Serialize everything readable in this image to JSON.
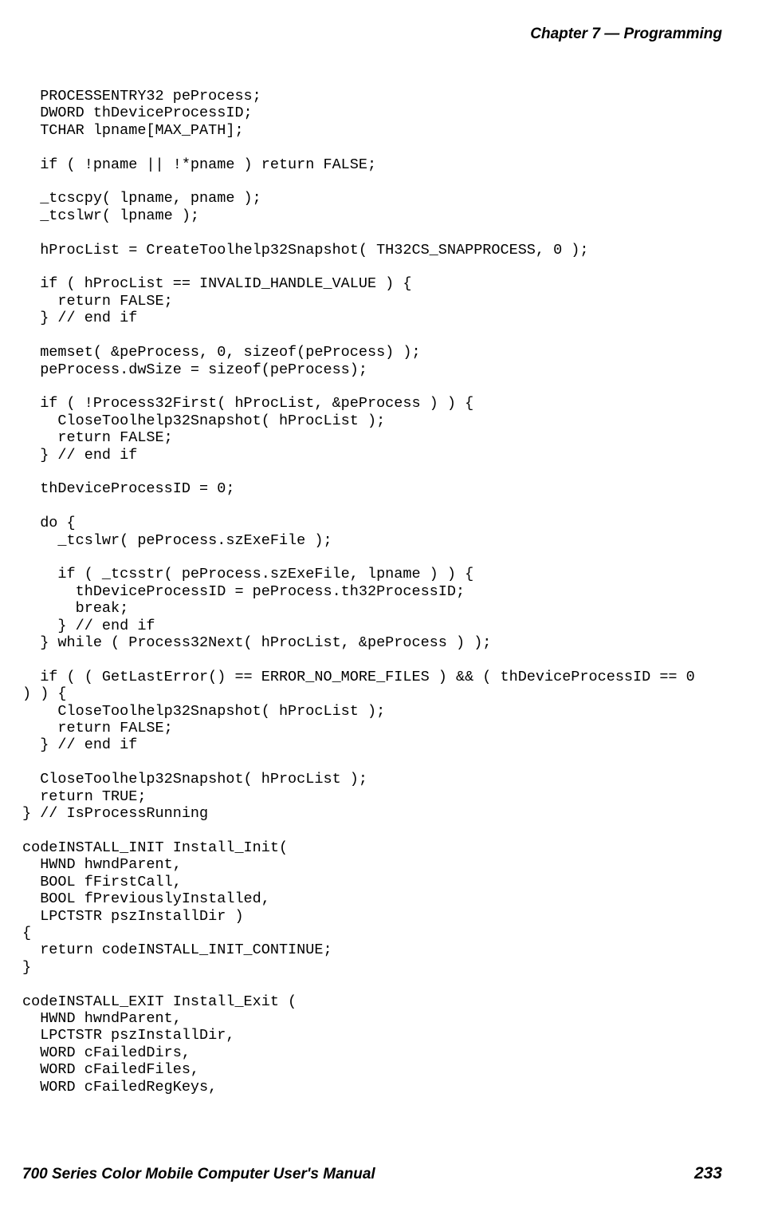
{
  "header": {
    "chapter": "Chapter 7 — Programming"
  },
  "code": "  PROCESSENTRY32 peProcess;\n  DWORD thDeviceProcessID;\n  TCHAR lpname[MAX_PATH];\n\n  if ( !pname || !*pname ) return FALSE;\n\n  _tcscpy( lpname, pname );\n  _tcslwr( lpname );\n\n  hProcList = CreateToolhelp32Snapshot( TH32CS_SNAPPROCESS, 0 );\n\n  if ( hProcList == INVALID_HANDLE_VALUE ) {\n    return FALSE;\n  } // end if\n\n  memset( &peProcess, 0, sizeof(peProcess) );\n  peProcess.dwSize = sizeof(peProcess);\n\n  if ( !Process32First( hProcList, &peProcess ) ) {\n    CloseToolhelp32Snapshot( hProcList );\n    return FALSE;\n  } // end if\n\n  thDeviceProcessID = 0;\n\n  do {\n    _tcslwr( peProcess.szExeFile );\n\n    if ( _tcsstr( peProcess.szExeFile, lpname ) ) {\n      thDeviceProcessID = peProcess.th32ProcessID;\n      break;\n    } // end if\n  } while ( Process32Next( hProcList, &peProcess ) );\n\n  if ( ( GetLastError() == ERROR_NO_MORE_FILES ) && ( thDeviceProcessID == 0\n) ) {\n    CloseToolhelp32Snapshot( hProcList );\n    return FALSE;\n  } // end if\n\n  CloseToolhelp32Snapshot( hProcList );\n  return TRUE;\n} // IsProcessRunning\n\ncodeINSTALL_INIT Install_Init(\n  HWND hwndParent,\n  BOOL fFirstCall,\n  BOOL fPreviouslyInstalled,\n  LPCTSTR pszInstallDir )\n{\n  return codeINSTALL_INIT_CONTINUE;\n}\n\ncodeINSTALL_EXIT Install_Exit (\n  HWND hwndParent,\n  LPCTSTR pszInstallDir,\n  WORD cFailedDirs,\n  WORD cFailedFiles,\n  WORD cFailedRegKeys,",
  "footer": {
    "manual_title": "700 Series Color Mobile Computer User's Manual",
    "page_number": "233"
  }
}
